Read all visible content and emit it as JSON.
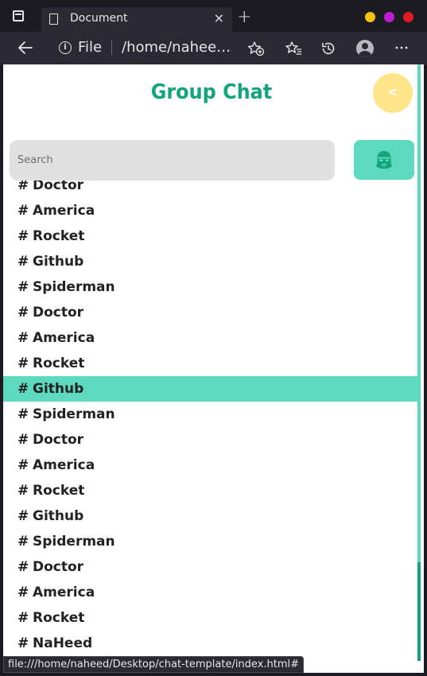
{
  "browser": {
    "tab_title": "Document",
    "tab_close": "×",
    "new_tab": "+",
    "url_scheme": "File",
    "url_path": "/home/naheed/Desktop/chat-template/index.html",
    "status_text": "file:///home/naheed/Desktop/chat-template/index.html#",
    "window_dots": [
      "#f5c211",
      "#c01cd1",
      "#e01b24"
    ],
    "icons": [
      "back-arrow-icon",
      "info-icon",
      "add-favorite-icon",
      "favorites-icon",
      "history-icon",
      "profile-icon",
      "more-icon"
    ]
  },
  "page": {
    "title": "Group Chat",
    "back_label": "<",
    "search_placeholder": "Search",
    "accent": "#12a47a",
    "highlight": "#5dd9bd",
    "back_button_color": "#fde58a"
  },
  "channels": {
    "hash": "#",
    "items": [
      "Doctor",
      "America",
      "Rocket",
      "Github",
      "Spiderman",
      "Doctor",
      "America",
      "Rocket",
      "Github",
      "Spiderman",
      "Doctor",
      "America",
      "Rocket",
      "Github",
      "Spiderman",
      "Doctor",
      "America",
      "Rocket",
      "NaHeed"
    ],
    "active_index": 8
  }
}
